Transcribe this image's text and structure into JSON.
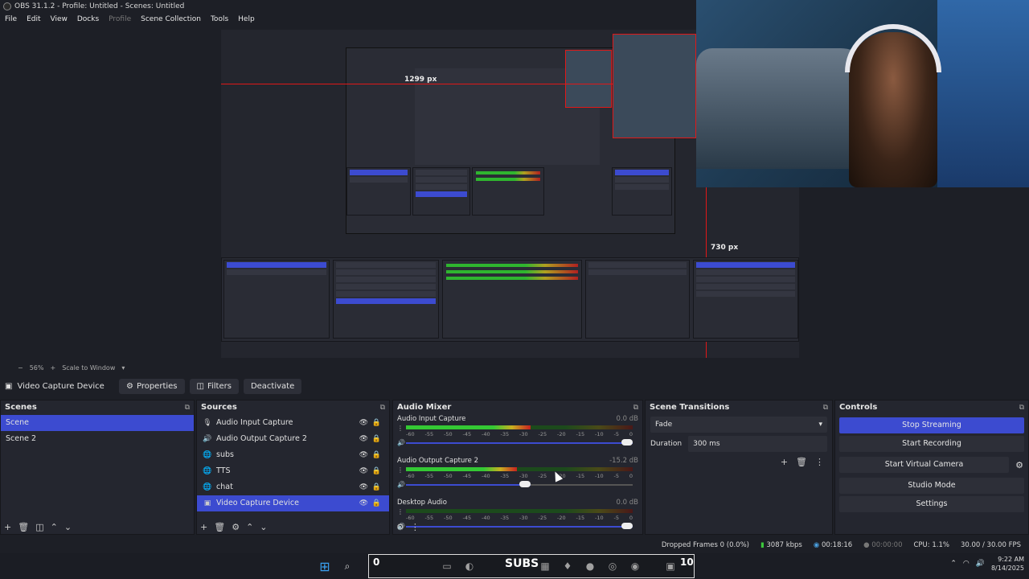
{
  "window": {
    "title": "OBS 31.1.2 - Profile: Untitled - Scenes: Untitled"
  },
  "menu": [
    "File",
    "Edit",
    "View",
    "Docks",
    "Profile",
    "Scene Collection",
    "Tools",
    "Help"
  ],
  "preview": {
    "width_label": "1299 px",
    "height_label": "730 px",
    "height_label_inner": "730 px",
    "zoom": "56%",
    "scale_mode": "Scale to Window"
  },
  "source_toolbar": {
    "selected_source": "Video Capture Device",
    "properties": "Properties",
    "filters": "Filters",
    "deactivate": "Deactivate"
  },
  "scenes": {
    "title": "Scenes",
    "items": [
      "Scene",
      "Scene 2"
    ],
    "selected": 0
  },
  "sources": {
    "title": "Sources",
    "items": [
      {
        "name": "Audio Input Capture",
        "icon": "mic-icon"
      },
      {
        "name": "Audio Output Capture 2",
        "icon": "speaker-icon"
      },
      {
        "name": "subs",
        "icon": "globe-icon"
      },
      {
        "name": "TTS",
        "icon": "globe-icon"
      },
      {
        "name": "chat",
        "icon": "globe-icon"
      },
      {
        "name": "Video Capture Device",
        "icon": "camera-icon"
      }
    ],
    "selected": 5
  },
  "mixer": {
    "title": "Audio Mixer",
    "scale": [
      "-60",
      "-55",
      "-50",
      "-45",
      "-40",
      "-35",
      "-30",
      "-25",
      "-20",
      "-15",
      "-10",
      "-5",
      "0"
    ],
    "channels": [
      {
        "name": "Audio Input Capture",
        "db": "0.0 dB",
        "level": 0.55,
        "volume": 1.0
      },
      {
        "name": "Audio Output Capture 2",
        "db": "-15.2 dB",
        "level": 0.49,
        "volume": 0.55
      },
      {
        "name": "Desktop Audio",
        "db": "0.0 dB",
        "level": 0.0,
        "volume": 1.0
      }
    ]
  },
  "transitions": {
    "title": "Scene Transitions",
    "selected": "Fade",
    "duration_label": "Duration",
    "duration_value": "300 ms"
  },
  "controls": {
    "title": "Controls",
    "buttons": [
      "Stop Streaming",
      "Start Recording",
      "Start Virtual Camera",
      "Studio Mode",
      "Settings"
    ]
  },
  "status": {
    "dropped_frames": "Dropped Frames 0 (0.0%)",
    "bitrate": "3087 kbps",
    "stream_time": "00:18:16",
    "rec_time": "00:00:00",
    "cpu": "CPU: 1.1%",
    "fps": "30.00 / 30.00 FPS"
  },
  "taskbar": {
    "search_placeholder": "Search",
    "subs_text": "SUBS",
    "zero": "0",
    "ten": "10",
    "time": "9:22 AM",
    "date": "8/14/2025"
  },
  "colors": {
    "accent": "#3c4bd0",
    "red": "#e01818",
    "green": "#34c834"
  }
}
